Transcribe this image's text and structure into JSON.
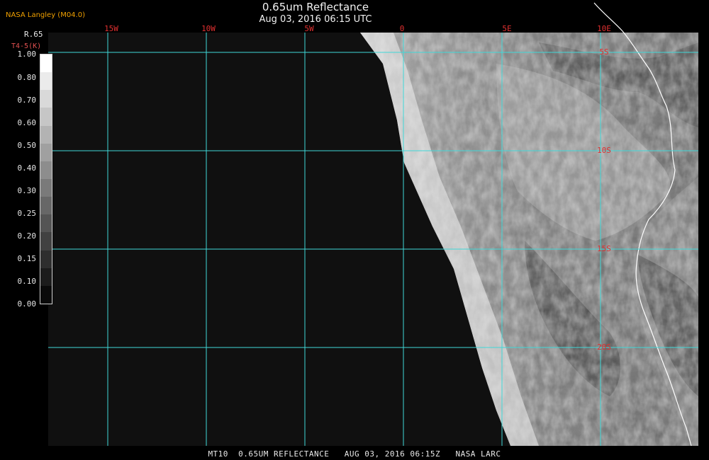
{
  "header": {
    "title": "0.65um Reflectance",
    "datetime": "Aug 03, 2016 06:15 UTC",
    "source": "NASA Langley (M04.0)"
  },
  "legend": {
    "variable": "R.65",
    "unit": "T4-5(K)",
    "labels": [
      "1.00",
      "0.80",
      "0.70",
      "0.60",
      "0.50",
      "0.40",
      "0.30",
      "0.25",
      "0.20",
      "0.15",
      "0.10",
      "0.00"
    ],
    "colors": [
      "#ffffff",
      "#ebebeb",
      "#d9d9d9",
      "#c6c6c6",
      "#b3b3b3",
      "#a0a0a0",
      "#8d8d8d",
      "#7a7a7a",
      "#676767",
      "#545454",
      "#414141",
      "#2e2e2e",
      "#1c1c1c",
      "#0a0a0a"
    ]
  },
  "map": {
    "lon_labels": [
      "15W",
      "10W",
      "5W",
      "0",
      "5E",
      "10E"
    ],
    "lat_labels": [
      "5S",
      "10S",
      "15S",
      "20S"
    ],
    "grid_color": "#3fd8d8",
    "label_color": "#e03030",
    "ocean_color": "#101010",
    "coast_color": "#ffffff"
  },
  "footer": {
    "text": "MT10  0.65UM REFLECTANCE   AUG 03, 2016 06:15Z   NASA LARC"
  }
}
